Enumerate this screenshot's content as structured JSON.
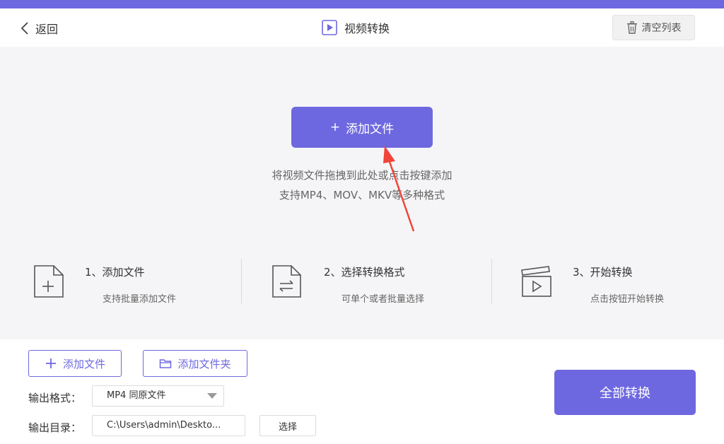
{
  "header": {
    "back_label": "返回",
    "title": "视频转换",
    "clear_label": "清空列表"
  },
  "dropzone": {
    "add_label": "添加文件",
    "add_prefix": "+",
    "hint_line1": "将视频文件拖拽到此处或点击按键添加",
    "hint_line2": "支持MP4、MOV、MKV等多种格式"
  },
  "steps": [
    {
      "title": "1、添加文件",
      "desc": "支持批量添加文件",
      "icon": "file-add-icon"
    },
    {
      "title": "2、选择转换格式",
      "desc": "可单个或者批量选择",
      "icon": "file-convert-icon"
    },
    {
      "title": "3、开始转换",
      "desc": "点击按钮开始转换",
      "icon": "clapperboard-play-icon"
    }
  ],
  "bottom": {
    "add_file_label": "添加文件",
    "add_folder_label": "添加文件夹",
    "format_label": "输出格式：",
    "format_value": "MP4 同原文件",
    "dir_label": "输出目录：",
    "dir_value": "C:\\Users\\admin\\Deskto...",
    "choose_label": "选择",
    "convert_all_label": "全部转换"
  },
  "colors": {
    "accent": "#6e68e0",
    "annotation_arrow": "#f0453a"
  }
}
